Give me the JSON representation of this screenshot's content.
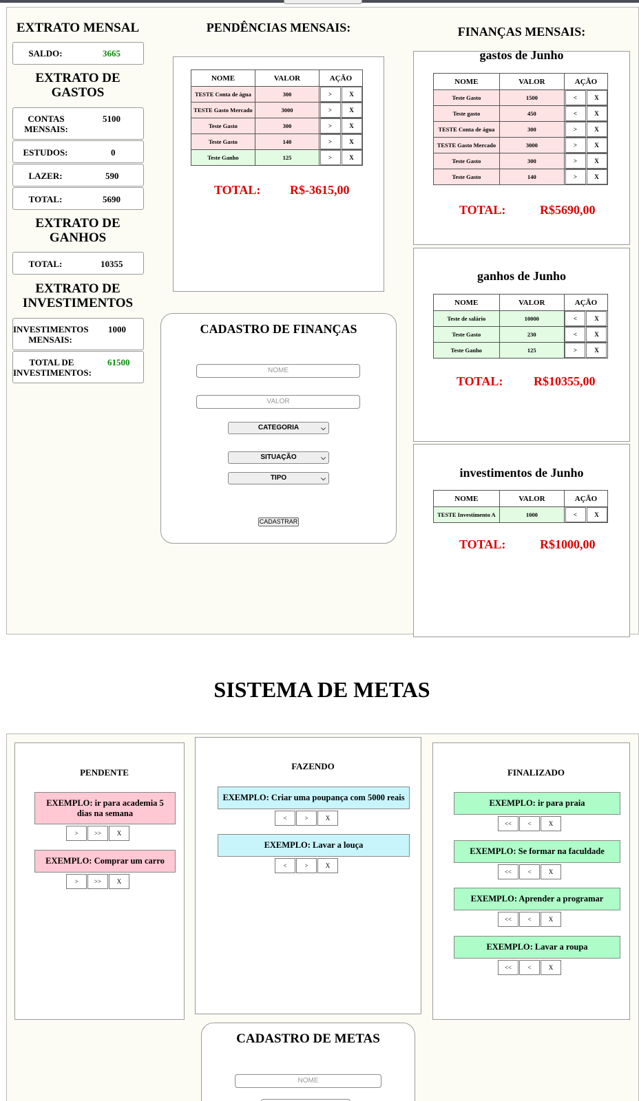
{
  "extrato": {
    "title": "EXTRATO MENSAL",
    "saldo_label": "SALDO:",
    "saldo_value": "3665",
    "gastos_title": "EXTRATO DE GASTOS",
    "contas_label": "CONTAS MENSAIS:",
    "contas_value": "5100",
    "estudos_label": "ESTUDOS:",
    "estudos_value": "0",
    "lazer_label": "LAZER:",
    "lazer_value": "590",
    "total_gastos_label": "TOTAL:",
    "total_gastos_value": "5690",
    "ganhos_title": "EXTRATO DE GANHOS",
    "total_ganhos_label": "TOTAL:",
    "total_ganhos_value": "10355",
    "invest_title": "EXTRATO DE INVESTIMENTOS",
    "invest_mensais_label": "INVESTIMENTOS MENSAIS:",
    "invest_mensais_value": "1000",
    "invest_total_label": "TOTAL DE INVESTIMENTOS:",
    "invest_total_value": "61500"
  },
  "pendencias": {
    "title": "PENDÊNCIAS MENSAIS:",
    "headers": [
      "NOME",
      "VALOR",
      "AÇÃO"
    ],
    "rows": [
      {
        "nome": "TESTE Conta de água",
        "valor": "300",
        "tone": "red",
        "b1": ">",
        "b2": "X"
      },
      {
        "nome": "TESTE Gasto Mercado",
        "valor": "3000",
        "tone": "red",
        "b1": ">",
        "b2": "X"
      },
      {
        "nome": "Teste Gasto",
        "valor": "300",
        "tone": "red",
        "b1": ">",
        "b2": "X"
      },
      {
        "nome": "Teste Gasto",
        "valor": "140",
        "tone": "red",
        "b1": ">",
        "b2": "X"
      },
      {
        "nome": "Teste Ganho",
        "valor": "125",
        "tone": "green",
        "b1": ">",
        "b2": "X"
      }
    ],
    "total_label": "TOTAL:",
    "total_value": "R$-3615,00"
  },
  "cadastro_financas": {
    "title": "CADASTRO DE FINANÇAS",
    "nome_placeholder": "NOME",
    "valor_placeholder": "VALOR",
    "categoria": "CATEGORIA",
    "situacao": "SITUAÇÃO",
    "tipo": "TIPO",
    "submit": "CADASTRAR"
  },
  "financas": {
    "title": "FINANÇAS MENSAIS:",
    "headers": [
      "NOME",
      "VALOR",
      "AÇÃO"
    ],
    "gastos": {
      "title": "gastos de Junho",
      "rows": [
        {
          "nome": "Teste Gasto",
          "valor": "1500",
          "tone": "red",
          "b1": "<",
          "b2": "X"
        },
        {
          "nome": "Teste gasto",
          "valor": "450",
          "tone": "red",
          "b1": "<",
          "b2": "X"
        },
        {
          "nome": "TESTE Conta de água",
          "valor": "300",
          "tone": "red",
          "b1": ">",
          "b2": "X"
        },
        {
          "nome": "TESTE Gasto Mercado",
          "valor": "3000",
          "tone": "red",
          "b1": ">",
          "b2": "X"
        },
        {
          "nome": "Teste Gasto",
          "valor": "300",
          "tone": "red",
          "b1": ">",
          "b2": "X"
        },
        {
          "nome": "Teste Gasto",
          "valor": "140",
          "tone": "red",
          "b1": ">",
          "b2": "X"
        }
      ],
      "total_label": "TOTAL:",
      "total_value": "R$5690,00"
    },
    "ganhos": {
      "title": "ganhos de Junho",
      "rows": [
        {
          "nome": "Teste de salário",
          "valor": "10000",
          "tone": "green",
          "b1": "<",
          "b2": "X"
        },
        {
          "nome": "Teste Gasto",
          "valor": "230",
          "tone": "green",
          "b1": "<",
          "b2": "X"
        },
        {
          "nome": "Teste Ganho",
          "valor": "125",
          "tone": "green",
          "b1": ">",
          "b2": "X"
        }
      ],
      "total_label": "TOTAL:",
      "total_value": "R$10355,00"
    },
    "investimentos": {
      "title": "investimentos de Junho",
      "rows": [
        {
          "nome": "TESTE Investimento A",
          "valor": "1000",
          "tone": "green",
          "b1": "<",
          "b2": "X"
        }
      ],
      "total_label": "TOTAL:",
      "total_value": "R$1000,00"
    }
  },
  "metas": {
    "title": "SISTEMA DE METAS",
    "pendente": {
      "title": "PENDENTE",
      "buttons": [
        ">",
        ">>",
        "X"
      ],
      "items": [
        "EXEMPLO: ir para academia 5 dias na semana",
        "EXEMPLO: Comprar um carro"
      ]
    },
    "fazendo": {
      "title": "FAZENDO",
      "buttons": [
        "<",
        ">",
        "X"
      ],
      "items": [
        "EXEMPLO: Criar uma poupança com 5000 reais",
        "EXEMPLO: Lavar a louça"
      ]
    },
    "finalizado": {
      "title": "FINALIZADO",
      "buttons": [
        "<<",
        "<",
        "X"
      ],
      "items": [
        "EXEMPLO: ir para praia",
        "EXEMPLO: Se formar na faculdade",
        "EXEMPLO: Aprender a programar",
        "EXEMPLO: Lavar a roupa"
      ]
    },
    "cadastro": {
      "title": "CADASTRO DE METAS",
      "nome_placeholder": "NOME"
    }
  },
  "colors": {
    "positive": "#0a8a0a",
    "total_red": "#e00000",
    "expense_row": "#fde3e4",
    "income_row": "#e3fae3",
    "pendente_card": "#ffc8d3",
    "fazendo_card": "#c8f5fc",
    "finalizado_card": "#aefcc8"
  }
}
